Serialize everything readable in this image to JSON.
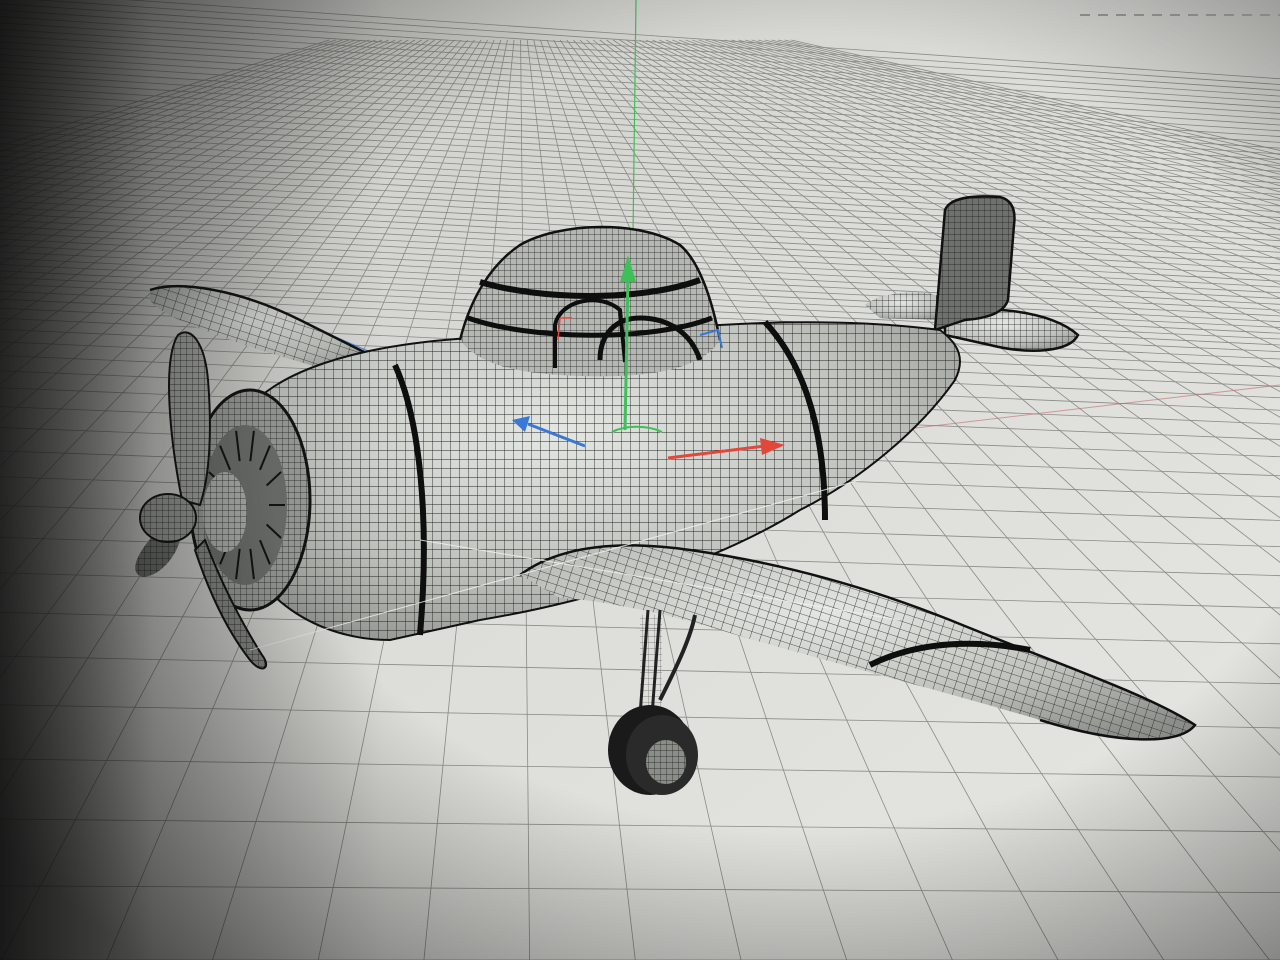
{
  "viewport": {
    "shading_mode": "wireframe-on-shaded",
    "background_color": "#d8d8d4",
    "grid_color": "#8a8a86",
    "model_base_color": "#c9cbc6",
    "wire_color": "#1c1c1c"
  },
  "gizmo": {
    "x_axis_color": "#e2473a",
    "y_axis_color": "#3fbf5a",
    "z_axis_color": "#3a78d8"
  },
  "model": {
    "icon": "airplane-icon",
    "parts": [
      "fuselage",
      "canopy",
      "propeller",
      "engine-cowl",
      "left-wing",
      "right-wing",
      "tail-fin",
      "horizontal-stabilizer",
      "landing-gear",
      "wheel"
    ]
  }
}
